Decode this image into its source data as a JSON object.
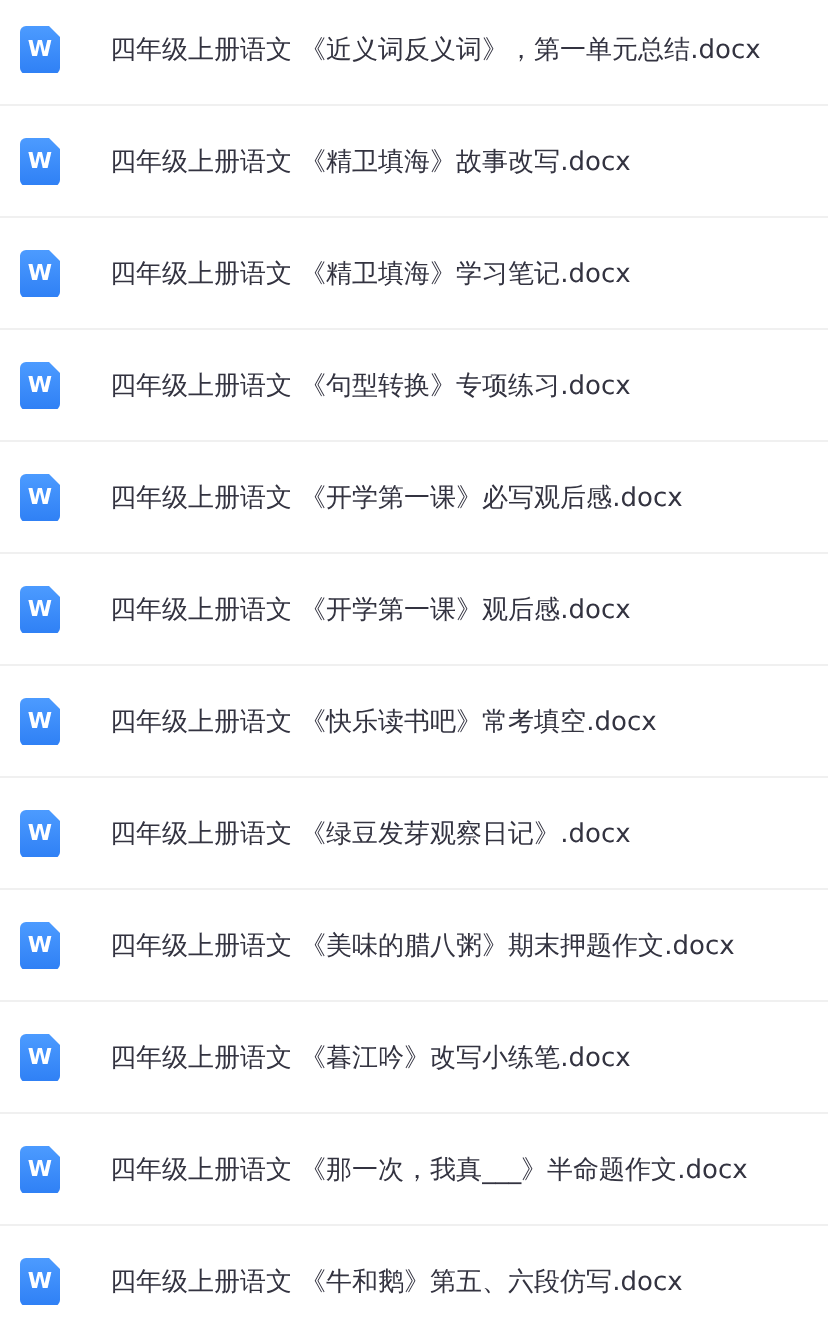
{
  "files": [
    {
      "icon_label": "W",
      "name": "四年级上册语文 《近义词反义词》，第一单元总结.docx"
    },
    {
      "icon_label": "W",
      "name": "四年级上册语文 《精卫填海》故事改写.docx"
    },
    {
      "icon_label": "W",
      "name": "四年级上册语文 《精卫填海》学习笔记.docx"
    },
    {
      "icon_label": "W",
      "name": "四年级上册语文 《句型转换》专项练习.docx"
    },
    {
      "icon_label": "W",
      "name": "四年级上册语文 《开学第一课》必写观后感.docx"
    },
    {
      "icon_label": "W",
      "name": "四年级上册语文 《开学第一课》观后感.docx"
    },
    {
      "icon_label": "W",
      "name": "四年级上册语文 《快乐读书吧》常考填空.docx"
    },
    {
      "icon_label": "W",
      "name": "四年级上册语文 《绿豆发芽观察日记》.docx"
    },
    {
      "icon_label": "W",
      "name": "四年级上册语文 《美味的腊八粥》期末押题作文.docx"
    },
    {
      "icon_label": "W",
      "name": "四年级上册语文 《暮江吟》改写小练笔.docx"
    },
    {
      "icon_label": "W",
      "name": "四年级上册语文 《那一次，我真___》半命题作文.docx"
    },
    {
      "icon_label": "W",
      "name": "四年级上册语文 《牛和鹅》第五、六段仿写.docx"
    }
  ]
}
